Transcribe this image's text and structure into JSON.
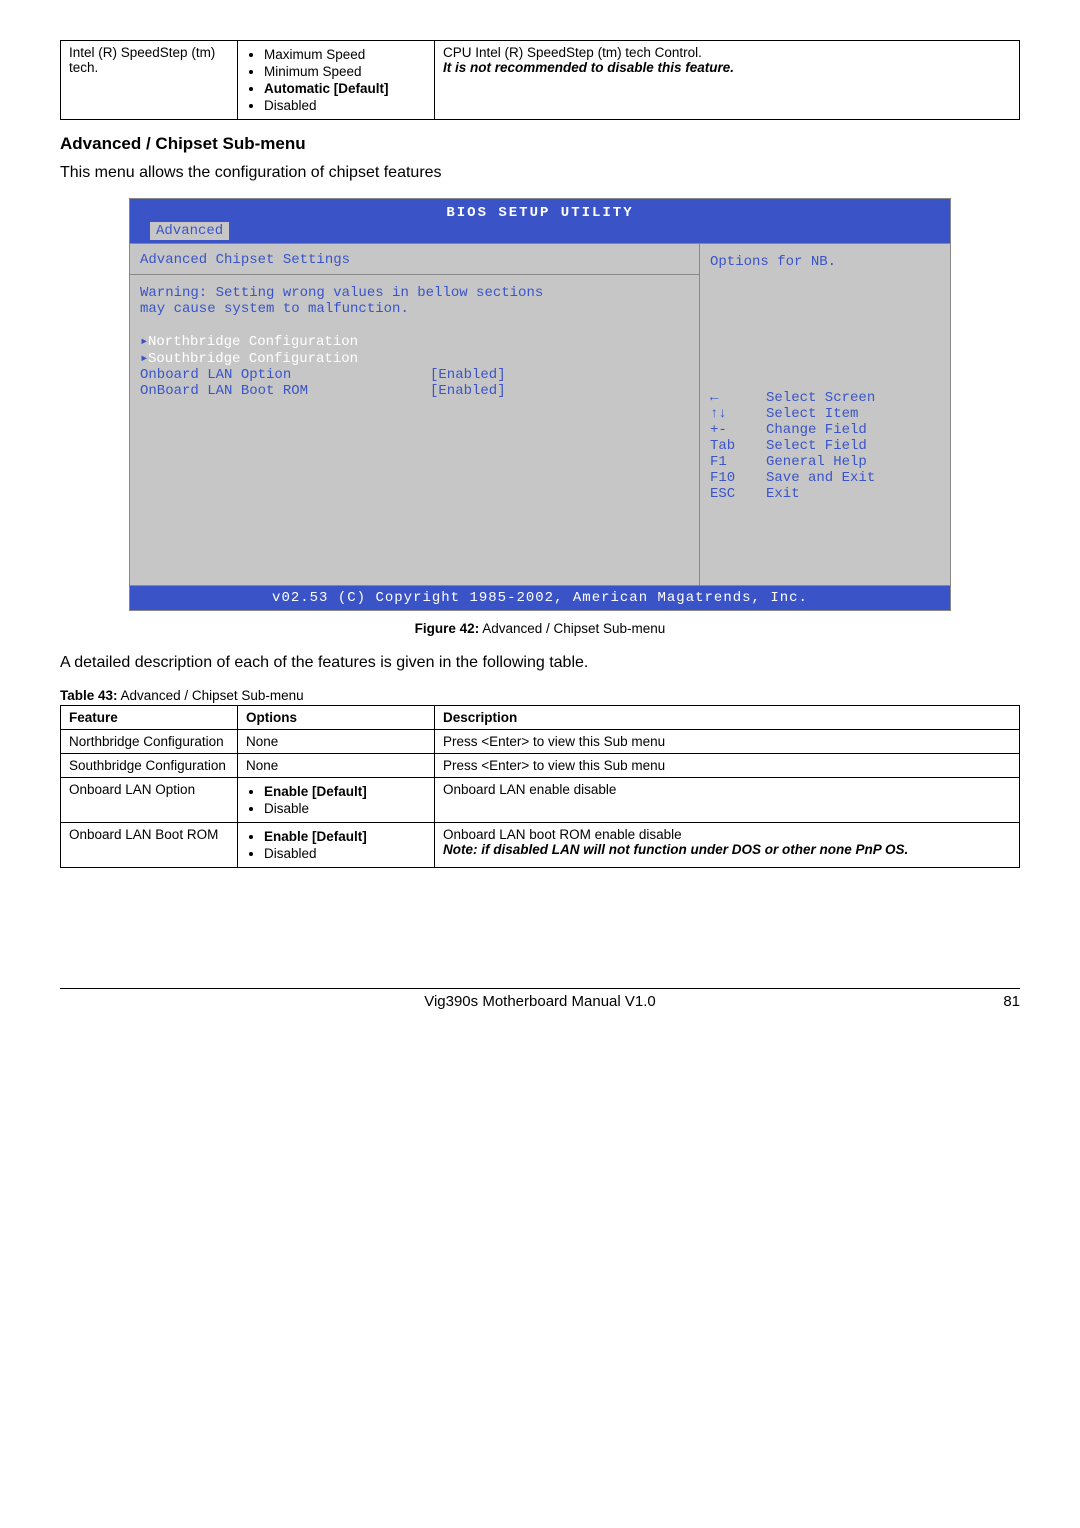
{
  "speedstep_table": {
    "feature": "Intel (R) SpeedStep (tm) tech.",
    "options": [
      "Maximum Speed",
      "Minimum Speed",
      "Automatic [Default]",
      "Disabled"
    ],
    "bold_option_index": 2,
    "desc_line1": "CPU Intel (R) SpeedStep (tm) tech Control.",
    "desc_line2": "It is not recommended to disable this feature."
  },
  "section_heading": "Advanced / Chipset Sub-menu",
  "section_intro": "This menu allows the configuration of chipset features",
  "bios": {
    "title": "BIOS SETUP UTILITY",
    "tab": "Advanced",
    "section_title": "Advanced Chipset Settings",
    "warning_l1": "Warning: Setting wrong values in bellow sections",
    "warning_l2": "         may cause system to malfunction.",
    "submenus": [
      "Northbridge Configuration",
      "Southbridge Configuration"
    ],
    "fields": [
      {
        "label": "Onboard LAN Option",
        "value": "[Enabled]"
      },
      {
        "label": "OnBoard LAN Boot ROM",
        "value": "[Enabled]"
      }
    ],
    "help_title": "Options for NB.",
    "keys": [
      {
        "k": "←",
        "d": "Select Screen"
      },
      {
        "k": "↑↓",
        "d": "Select Item"
      },
      {
        "k": "+-",
        "d": "Change Field"
      },
      {
        "k": "Tab",
        "d": "Select Field"
      },
      {
        "k": "F1",
        "d": "General Help"
      },
      {
        "k": "F10",
        "d": "Save and Exit"
      },
      {
        "k": "ESC",
        "d": "Exit"
      }
    ],
    "footer": "v02.53 (C) Copyright 1985-2002, American Magatrends, Inc."
  },
  "figure": {
    "label": "Figure 42:",
    "text": " Advanced / Chipset Sub-menu"
  },
  "desc_para": "A detailed description of each of the features is given in the following table.",
  "table43_caption": {
    "label": "Table 43:",
    "text": " Advanced / Chipset Sub-menu"
  },
  "table43": {
    "headers": [
      "Feature",
      "Options",
      "Description"
    ],
    "rows": [
      {
        "feature": "Northbridge Configuration",
        "options_plain": "None",
        "desc": "Press <Enter> to view this Sub menu"
      },
      {
        "feature": "Southbridge Configuration",
        "options_plain": "None",
        "desc": "Press <Enter> to view this Sub menu"
      },
      {
        "feature": "Onboard LAN Option",
        "options_list": [
          "Enable [Default]",
          "Disable"
        ],
        "bold_option_index": 0,
        "desc": "Onboard LAN enable disable"
      },
      {
        "feature": "Onboard LAN Boot ROM",
        "options_list": [
          "Enable [Default]",
          "Disabled"
        ],
        "bold_option_index": 0,
        "desc_line1": "Onboard LAN boot ROM enable disable",
        "desc_note": "Note: if disabled LAN will not function under DOS or other none PnP OS."
      }
    ]
  },
  "footer": {
    "center": "Vig390s Motherboard Manual V1.0",
    "page": "81"
  }
}
